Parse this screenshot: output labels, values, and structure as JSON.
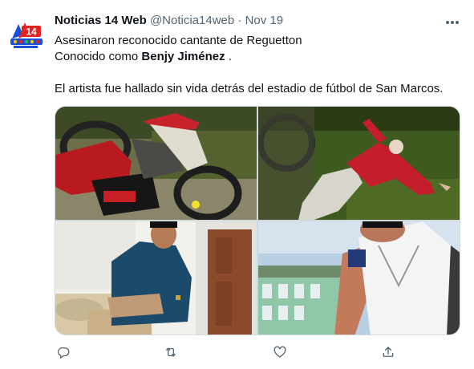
{
  "tweet": {
    "author_name": "Noticias 14 Web",
    "author_handle": "@Noticia14web",
    "separator": "·",
    "timestamp": "Nov 19",
    "avatar_text": "14",
    "text_line_1": "Asesinaron reconocido cantante de Reguetton",
    "text_line_2_prefix": "Conocido como ",
    "text_line_2_bold": "Benjy Jiménez",
    "text_line_2_suffix": " .",
    "text_line_3": "El artista fue hallado sin vida detrás del estadio de fútbol de San Marcos."
  },
  "media": {
    "photos": [
      {
        "name": "photo-motorcycle-scene"
      },
      {
        "name": "photo-body-in-grass"
      },
      {
        "name": "photo-man-seated"
      },
      {
        "name": "photo-selfie"
      }
    ]
  },
  "actions": {
    "icons": [
      "reply-icon",
      "retweet-icon",
      "like-icon",
      "share-icon"
    ]
  },
  "colors": {
    "text": "#0f1419",
    "secondary": "#536471",
    "border": "#cfd9de",
    "background": "#ffffff"
  }
}
